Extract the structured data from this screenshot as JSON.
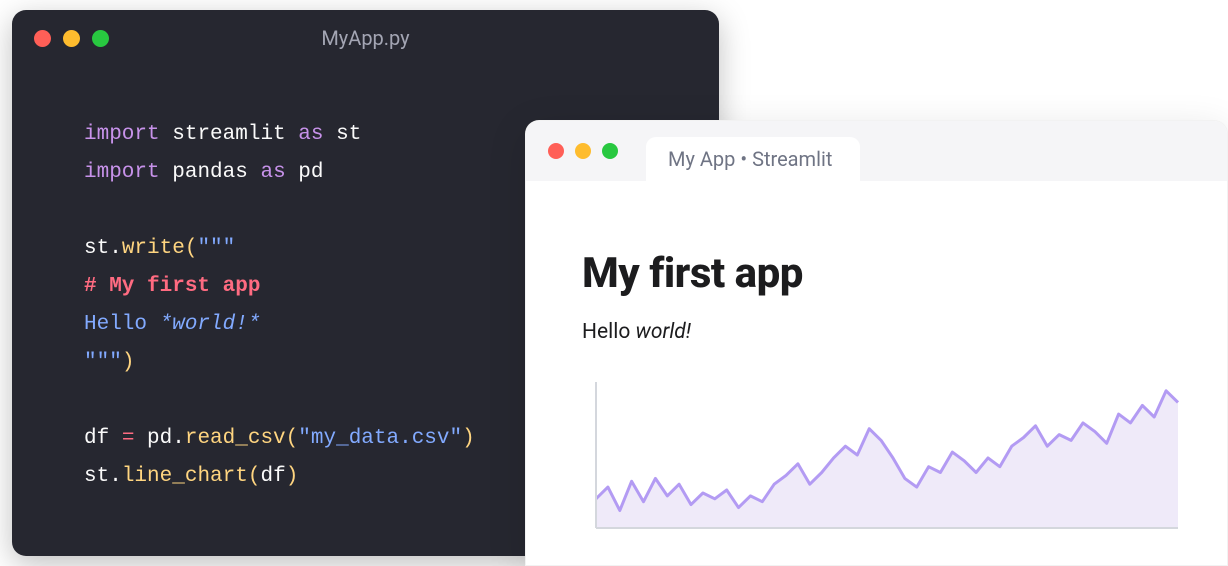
{
  "editor": {
    "filename": "MyApp.py",
    "code": {
      "import1a": "import",
      "import1b": "streamlit",
      "import1c": "as",
      "import1d": "st",
      "import2a": "import",
      "import2b": "pandas",
      "import2c": "as",
      "import2d": "pd",
      "l3a": "st",
      "l3b": ".",
      "l3c": "write",
      "l3d": "(",
      "l3e": "\"\"\"",
      "l4": "# My first app",
      "l5a": "Hello ",
      "l5b": "*world!*",
      "l6a": "\"\"\"",
      "l6b": ")",
      "l7a": "df ",
      "l7b": "=",
      "l7c": " pd",
      "l7d": ".",
      "l7e": "read_csv",
      "l7f": "(",
      "l7g": "\"my_data.csv\"",
      "l7h": ")",
      "l8a": "st",
      "l8b": ".",
      "l8c": "line_chart",
      "l8d": "(",
      "l8e": "df",
      "l8f": ")"
    }
  },
  "browser": {
    "tab_title": "My App • Streamlit",
    "heading": "My first app",
    "text_plain": "Hello ",
    "text_italic": "world!"
  },
  "chart_data": {
    "type": "area",
    "title": "",
    "xlabel": "",
    "ylabel": "",
    "ylim": [
      0,
      100
    ],
    "x": [
      0,
      1,
      2,
      3,
      4,
      5,
      6,
      7,
      8,
      9,
      10,
      11,
      12,
      13,
      14,
      15,
      16,
      17,
      18,
      19,
      20,
      21,
      22,
      23,
      24,
      25,
      26,
      27,
      28,
      29,
      30,
      31,
      32,
      33,
      34,
      35,
      36,
      37,
      38,
      39,
      40,
      41,
      42,
      43,
      44,
      45,
      46,
      47,
      48,
      49
    ],
    "values": [
      20,
      28,
      12,
      32,
      18,
      34,
      22,
      30,
      16,
      24,
      20,
      26,
      14,
      22,
      18,
      30,
      36,
      44,
      30,
      38,
      48,
      56,
      50,
      68,
      60,
      48,
      34,
      28,
      42,
      38,
      52,
      46,
      38,
      48,
      42,
      56,
      62,
      70,
      56,
      64,
      60,
      72,
      66,
      58,
      78,
      72,
      84,
      76,
      94,
      86
    ],
    "stroke": "#b39bf3",
    "fill": "#efeaf9",
    "axis": "#d4d7dd"
  }
}
